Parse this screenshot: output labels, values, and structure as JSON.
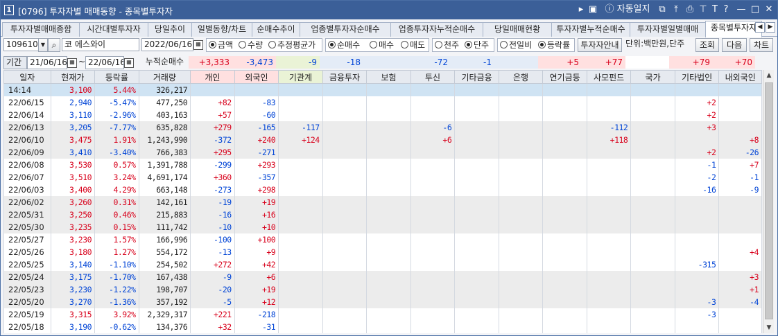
{
  "window": {
    "number": "1",
    "title": "[0796] 투자자별 매매동향 - 종목별투자자",
    "title_buttons": [
      "▸",
      "▣",
      "ⓘ 자동일지",
      "⧉",
      "⤒",
      "⎙",
      "⊤",
      "T",
      "?",
      "—",
      "□",
      "✕"
    ]
  },
  "tabs": [
    "투자자별매매종합",
    "시간대별투자자",
    "당일추이",
    "일별동향/차트",
    "순매수추이",
    "업종별투자자순매수",
    "업종투자자누적순매수",
    "당일매매현황",
    "투자자별누적순매수",
    "투자자별일별매매",
    "종목별투자자"
  ],
  "active_tab": "종목별투자자",
  "controls": {
    "code": "109610",
    "name_prefix": "코",
    "name": "에스와이",
    "date": "2022/06/16",
    "radios_value": [
      "금액",
      "수량",
      "추정평균가"
    ],
    "value_selected": "금액",
    "radios_side": [
      "순매수",
      "매수",
      "매도"
    ],
    "side_selected": "순매수",
    "radios_unit": [
      "천주",
      "단주"
    ],
    "unit_selected": "단주",
    "radios_comp": [
      "전일비",
      "등락률"
    ],
    "comp_selected": "등락률",
    "investor_info_button": "투자자안내",
    "unit_text": "단위:백만원,단주",
    "query_button": "조회",
    "next_button": "다음",
    "chart_button": "차트"
  },
  "period": {
    "label": "기간",
    "from": "21/06/16",
    "to": "22/06/16",
    "cum_label": "누적순매수"
  },
  "sums": [
    "+3,333",
    "-3,473",
    "-9",
    "-18",
    "",
    "-72",
    "-1",
    "",
    "+5",
    "+77",
    "",
    "+79",
    "+70"
  ],
  "columns": [
    "일자",
    "현재가",
    "등락률",
    "거래량",
    "개인",
    "외국인",
    "기관계",
    "금융투자",
    "보험",
    "투신",
    "기타금융",
    "은행",
    "연기금등",
    "사모펀드",
    "국가",
    "기타법인",
    "내외국인"
  ],
  "rows": [
    [
      "14:14",
      "3,100",
      "5.44%",
      "326,217",
      "",
      "",
      "",
      "",
      "",
      "",
      "",
      "",
      "",
      "",
      "",
      "",
      ""
    ],
    [
      "22/06/15",
      "2,940",
      "-5.47%",
      "477,250",
      "+82",
      "-83",
      "",
      "",
      "",
      "",
      "",
      "",
      "",
      "",
      "",
      "+2",
      ""
    ],
    [
      "22/06/14",
      "3,110",
      "-2.96%",
      "403,163",
      "+57",
      "-60",
      "",
      "",
      "",
      "",
      "",
      "",
      "",
      "",
      "",
      "+2",
      ""
    ],
    [
      "22/06/13",
      "3,205",
      "-7.77%",
      "635,828",
      "+279",
      "-165",
      "-117",
      "",
      "",
      "-6",
      "",
      "",
      "",
      "-112",
      "",
      "+3",
      ""
    ],
    [
      "22/06/10",
      "3,475",
      "1.91%",
      "1,243,990",
      "-372",
      "+240",
      "+124",
      "",
      "",
      "+6",
      "",
      "",
      "",
      "+118",
      "",
      "",
      "+8"
    ],
    [
      "22/06/09",
      "3,410",
      "-3.40%",
      "766,383",
      "+295",
      "-271",
      "",
      "",
      "",
      "",
      "",
      "",
      "",
      "",
      "",
      "+2",
      "-26"
    ],
    [
      "22/06/08",
      "3,530",
      "0.57%",
      "1,391,788",
      "-299",
      "+293",
      "",
      "",
      "",
      "",
      "",
      "",
      "",
      "",
      "",
      "-1",
      "+7"
    ],
    [
      "22/06/07",
      "3,510",
      "3.24%",
      "4,691,174",
      "+360",
      "-357",
      "",
      "",
      "",
      "",
      "",
      "",
      "",
      "",
      "",
      "-2",
      "-1"
    ],
    [
      "22/06/03",
      "3,400",
      "4.29%",
      "663,148",
      "-273",
      "+298",
      "",
      "",
      "",
      "",
      "",
      "",
      "",
      "",
      "",
      "-16",
      "-9"
    ],
    [
      "22/06/02",
      "3,260",
      "0.31%",
      "142,161",
      "-19",
      "+19",
      "",
      "",
      "",
      "",
      "",
      "",
      "",
      "",
      "",
      "",
      ""
    ],
    [
      "22/05/31",
      "3,250",
      "0.46%",
      "215,883",
      "-16",
      "+16",
      "",
      "",
      "",
      "",
      "",
      "",
      "",
      "",
      "",
      "",
      ""
    ],
    [
      "22/05/30",
      "3,235",
      "0.15%",
      "111,742",
      "-10",
      "+10",
      "",
      "",
      "",
      "",
      "",
      "",
      "",
      "",
      "",
      "",
      ""
    ],
    [
      "22/05/27",
      "3,230",
      "1.57%",
      "166,996",
      "-100",
      "+100",
      "",
      "",
      "",
      "",
      "",
      "",
      "",
      "",
      "",
      "",
      ""
    ],
    [
      "22/05/26",
      "3,180",
      "1.27%",
      "554,172",
      "-13",
      "+9",
      "",
      "",
      "",
      "",
      "",
      "",
      "",
      "",
      "",
      "",
      "+4"
    ],
    [
      "22/05/25",
      "3,140",
      "-1.10%",
      "254,502",
      "+272",
      "+42",
      "",
      "",
      "",
      "",
      "",
      "",
      "",
      "",
      "",
      "-315",
      ""
    ],
    [
      "22/05/24",
      "3,175",
      "-1.70%",
      "167,438",
      "-9",
      "+6",
      "",
      "",
      "",
      "",
      "",
      "",
      "",
      "",
      "",
      "",
      "+3"
    ],
    [
      "22/05/23",
      "3,230",
      "-1.22%",
      "198,707",
      "-20",
      "+19",
      "",
      "",
      "",
      "",
      "",
      "",
      "",
      "",
      "",
      "",
      "+1"
    ],
    [
      "22/05/20",
      "3,270",
      "-1.36%",
      "357,192",
      "-5",
      "+12",
      "",
      "",
      "",
      "",
      "",
      "",
      "",
      "",
      "",
      "-3",
      "-4"
    ],
    [
      "22/05/19",
      "3,315",
      "3.92%",
      "2,329,317",
      "+221",
      "-218",
      "",
      "",
      "",
      "",
      "",
      "",
      "",
      "",
      "",
      "-3",
      ""
    ],
    [
      "22/05/18",
      "3,190",
      "-0.62%",
      "134,376",
      "+32",
      "-31",
      "",
      "",
      "",
      "",
      "",
      "",
      "",
      "",
      "",
      "",
      ""
    ]
  ],
  "colors": {
    "up": "#d8001b",
    "down": "#0044d6",
    "title": "#3b5f98",
    "selected_row": "#cfe3f3"
  }
}
